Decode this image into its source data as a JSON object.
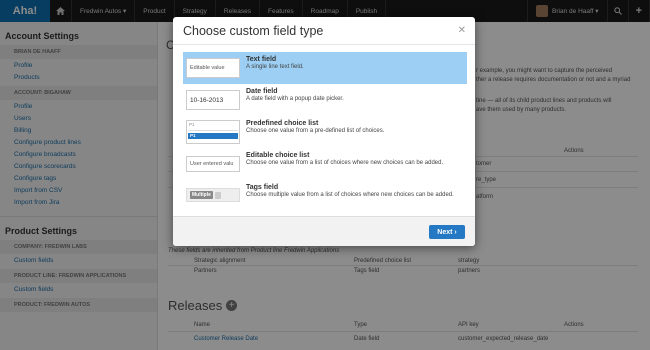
{
  "nav": {
    "logo": "Aha!",
    "home_icon": "home-icon",
    "items": [
      "Fredwin Autos ▾",
      "Product",
      "Strategy",
      "Releases",
      "Features",
      "Roadmap",
      "Publish"
    ],
    "user": "Brian de Haaff ▾",
    "search_icon": "search-icon",
    "add_icon": "plus-icon"
  },
  "sidebar": {
    "account_title": "Account Settings",
    "sections": [
      {
        "heading": "BRIAN DE HAAFF",
        "links": [
          "Profile",
          "Products"
        ]
      },
      {
        "heading": "ACCOUNT: BIGAHAW",
        "links": [
          "Profile",
          "Users",
          "Billing",
          "Configure product lines",
          "Configure broadcasts",
          "Configure scorecards",
          "Configure tags",
          "Import from CSV",
          "Import from Jira"
        ]
      }
    ],
    "product_title": "Product Settings",
    "product_sections": [
      {
        "heading": "COMPANY: FREDWIN LABS",
        "links": [
          "Custom fields"
        ]
      },
      {
        "heading": "PRODUCT LINE: FREDWIN APPLICATIONS",
        "links": [
          "Custom fields"
        ]
      },
      {
        "heading": "PRODUCT: FREDWIN AUTOS",
        "links": []
      }
    ]
  },
  "main": {
    "title_letter": "C",
    "intro_right_1": "r example, you might want to capture the perceived",
    "intro_right_2": "ther a release requires documentation or not and a myriad",
    "intro_right_3": "tine — all of its child product lines and products will",
    "intro_right_4": "ave them used by many products.",
    "actions_header": "Actions",
    "keys": [
      "tomer",
      "re_type",
      "atform"
    ],
    "inherited_note": "These fields are inherited from Product line Fredwin Applications",
    "inherited_rows": [
      {
        "name": "Strategic alignment",
        "type": "Predefined choice list",
        "key": "strategy"
      },
      {
        "name": "Partners",
        "type": "Tags field",
        "key": "partners"
      }
    ],
    "releases_title": "Releases",
    "releases_columns": {
      "name": "Name",
      "type": "Type",
      "key": "API key",
      "actions": "Actions"
    },
    "releases_row": {
      "name": "Customer Release Date",
      "type": "Date field",
      "key": "customer_expected_release_date"
    }
  },
  "modal": {
    "title": "Choose custom field type",
    "close_icon": "close-icon",
    "options": [
      {
        "name": "Text field",
        "desc": "A single line text field.",
        "preview": "Editable value"
      },
      {
        "name": "Date field",
        "desc": "A date field with a popup date picker.",
        "preview": "10-16-2013"
      },
      {
        "name": "Predefined choice list",
        "desc": "Choose one value from a pre-defined list of choices.",
        "preview": "P1"
      },
      {
        "name": "Editable choice list",
        "desc": "Choose one value from a list of choices where new choices can be added.",
        "preview": "User entered valu"
      },
      {
        "name": "Tags field",
        "desc": "Choose multiple value from a list of choices where new choices can be added.",
        "preview": "Multiple"
      }
    ],
    "next_label": "Next ›"
  },
  "colors": {
    "accent": "#2478c4",
    "selected": "#9ccff3",
    "nav": "#1a1a1a",
    "logo": "#0b6fb0"
  }
}
